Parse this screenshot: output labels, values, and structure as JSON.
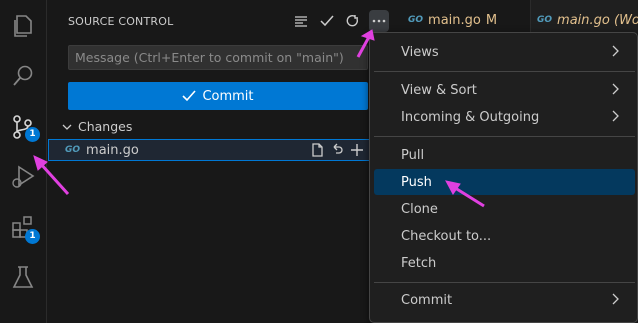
{
  "activity_bar": {
    "items": [
      {
        "name": "explorer"
      },
      {
        "name": "search"
      },
      {
        "name": "source-control",
        "badge": "1"
      },
      {
        "name": "run-and-debug"
      },
      {
        "name": "extensions",
        "badge": "1"
      },
      {
        "name": "testing"
      }
    ]
  },
  "source_control": {
    "title": "SOURCE CONTROL",
    "message_placeholder": "Message (Ctrl+Enter to commit on \"main\")",
    "commit_label": "Commit",
    "changes_label": "Changes",
    "file": {
      "lang_tag": "GO",
      "name": "main.go"
    }
  },
  "tabs": [
    {
      "lang_tag": "GO",
      "label": "main.go",
      "status": "M"
    },
    {
      "lang_tag": "GO",
      "label": "main.go (Wo"
    }
  ],
  "menu": {
    "groups": [
      [
        "Views"
      ],
      [
        "View & Sort",
        "Incoming & Outgoing"
      ],
      [
        "Pull",
        "Push",
        "Clone",
        "Checkout to...",
        "Fetch"
      ],
      [
        "Commit"
      ]
    ],
    "highlighted": "Push"
  },
  "colors": {
    "accent": "#0078d4",
    "annotation_arrow": "#e040e0",
    "menu_highlight": "#04395e",
    "modified_tab": "#e2c08d"
  }
}
